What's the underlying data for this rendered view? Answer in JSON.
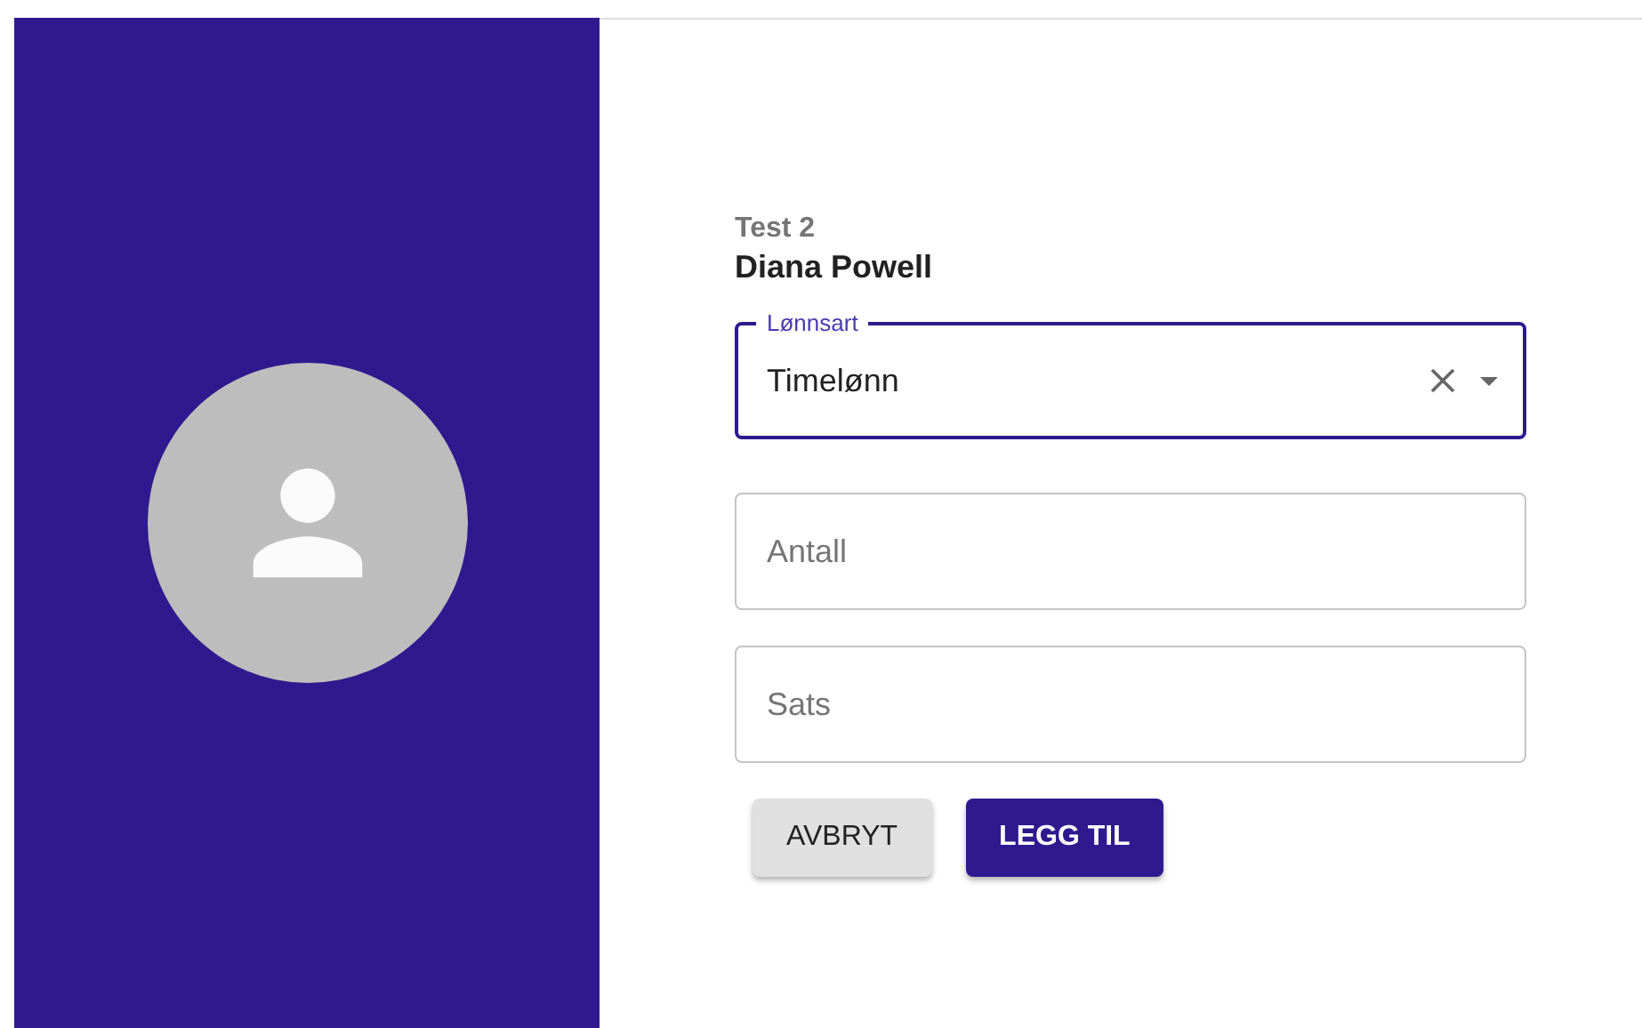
{
  "profile": {
    "subtitle": "Test 2",
    "name": "Diana Powell"
  },
  "select": {
    "label": "Lønnsart",
    "value": "Timelønn",
    "focused": true
  },
  "fields": [
    {
      "placeholder": "Antall"
    },
    {
      "placeholder": "Sats"
    }
  ],
  "buttons": [
    {
      "label": "AVBRYT",
      "kind": "secondary"
    },
    {
      "label": "LEGG TIL",
      "kind": "primary"
    }
  ]
}
